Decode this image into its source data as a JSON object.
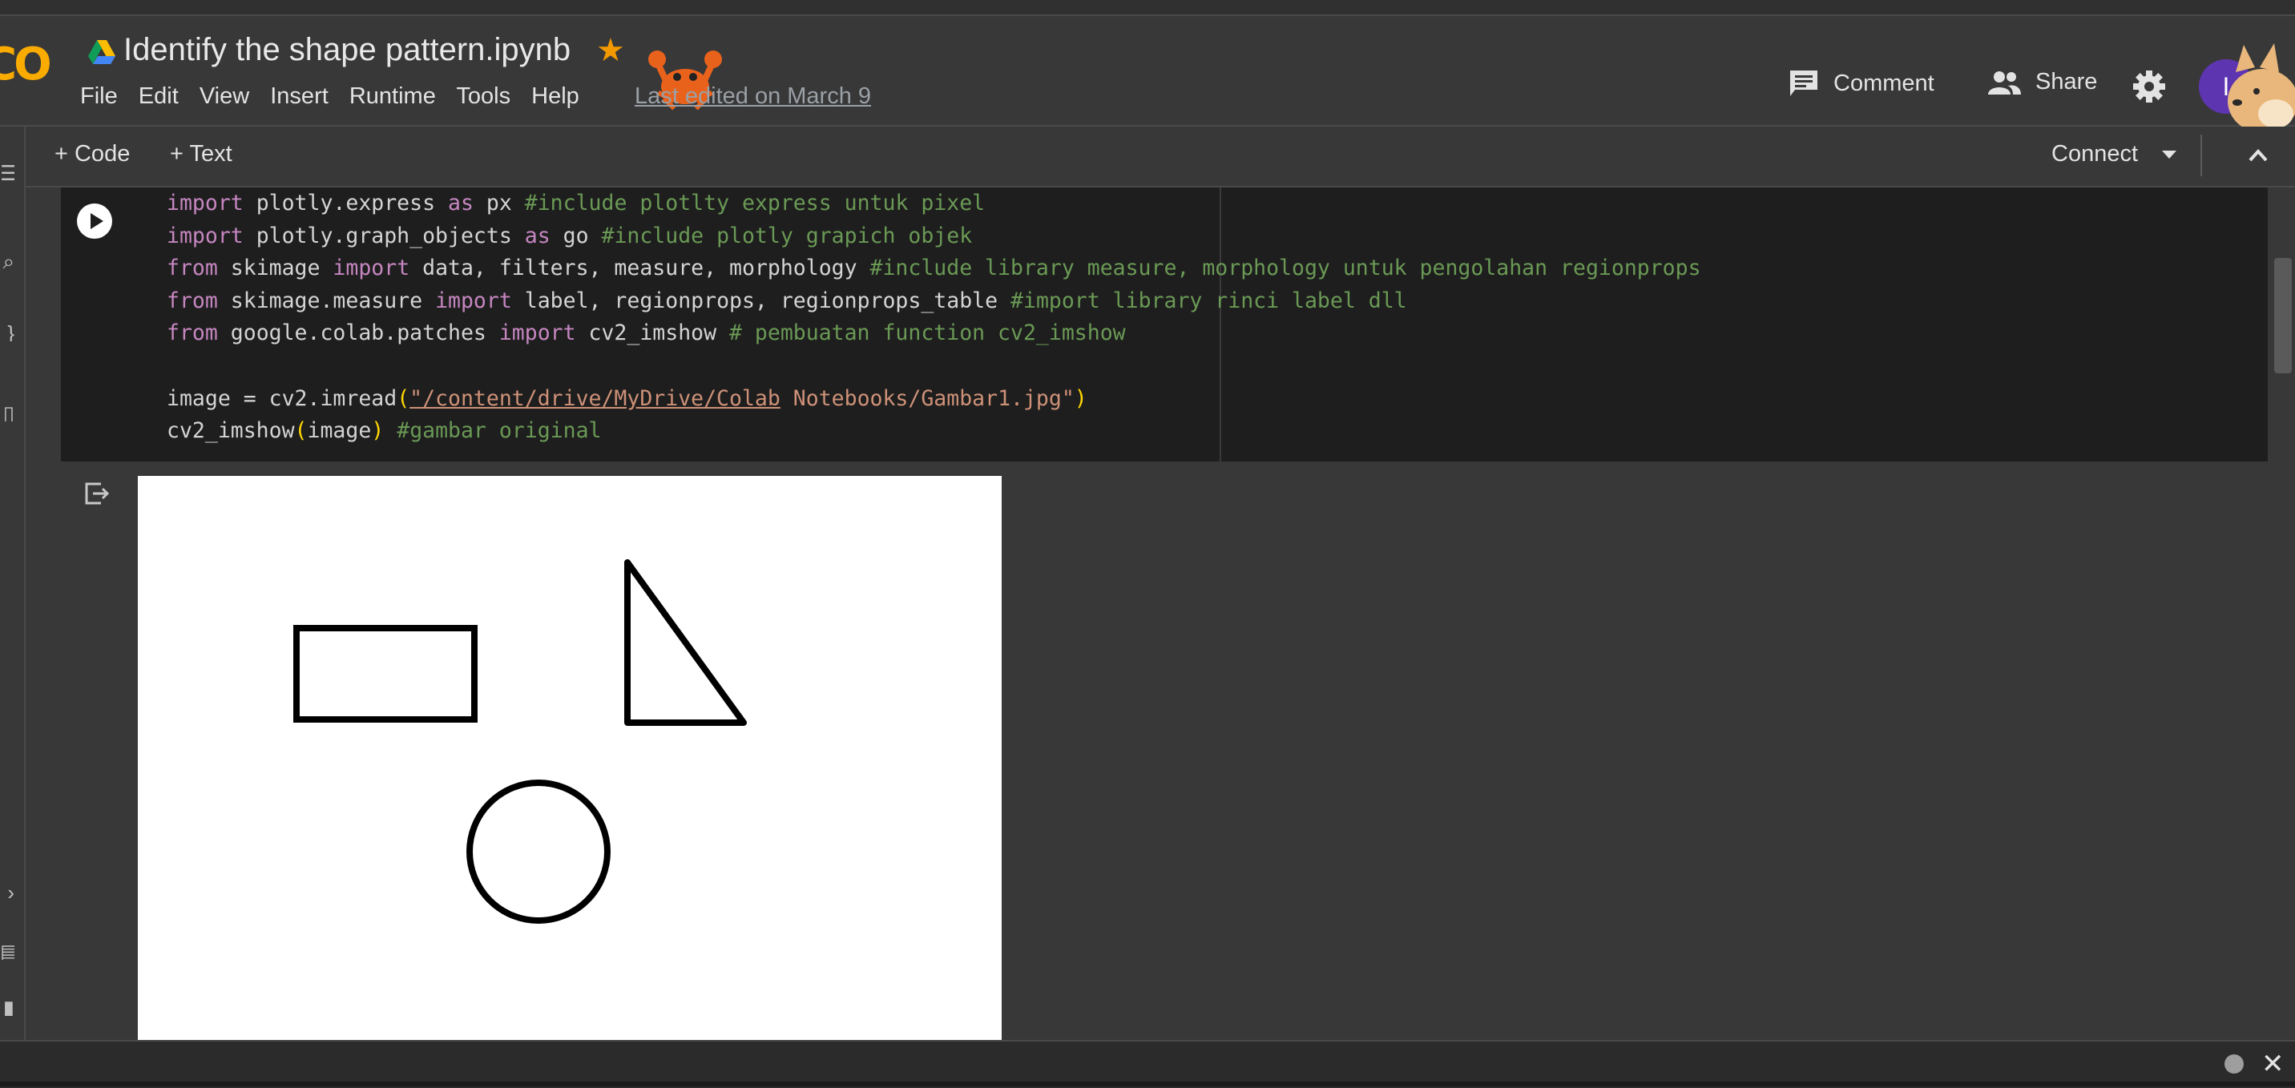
{
  "header": {
    "logo_text": "CO",
    "title": "Identify the shape pattern.ipynb",
    "last_edited": "Last edited on March 9",
    "comment_label": "Comment",
    "share_label": "Share",
    "avatar_initial": "I",
    "star_icon": "star-icon",
    "colors": {
      "logo": "#f9ab00",
      "star": "#f29900",
      "avatar": "#5e35b1"
    }
  },
  "menu": [
    "File",
    "Edit",
    "View",
    "Insert",
    "Runtime",
    "Tools",
    "Help"
  ],
  "toolbar": {
    "add_code_label": "+ Code",
    "add_text_label": "+ Text",
    "connect_label": "Connect"
  },
  "code_cell": {
    "lines": [
      [
        {
          "t": "import",
          "c": "kw"
        },
        {
          "t": " plotly.express ",
          "c": ""
        },
        {
          "t": "as",
          "c": "kw"
        },
        {
          "t": " px ",
          "c": ""
        },
        {
          "t": "#include plotlty express untuk pixel",
          "c": "cm"
        }
      ],
      [
        {
          "t": "import",
          "c": "kw"
        },
        {
          "t": " plotly.graph_objects ",
          "c": ""
        },
        {
          "t": "as",
          "c": "kw"
        },
        {
          "t": " go ",
          "c": ""
        },
        {
          "t": "#include plotly grapich objek",
          "c": "cm"
        }
      ],
      [
        {
          "t": "from",
          "c": "kw"
        },
        {
          "t": " skimage ",
          "c": ""
        },
        {
          "t": "import",
          "c": "kw"
        },
        {
          "t": " data, filters, measure, morphology ",
          "c": ""
        },
        {
          "t": "#include library measure, morphology untuk pengolahan regionprops",
          "c": "cm"
        }
      ],
      [
        {
          "t": "from",
          "c": "kw"
        },
        {
          "t": " skimage.measure ",
          "c": ""
        },
        {
          "t": "import",
          "c": "kw"
        },
        {
          "t": " label, regionprops, regionprops_table ",
          "c": ""
        },
        {
          "t": "#import library rinci label dll",
          "c": "cm"
        }
      ],
      [
        {
          "t": "from",
          "c": "kw"
        },
        {
          "t": " google.colab.patches ",
          "c": ""
        },
        {
          "t": "import",
          "c": "kw"
        },
        {
          "t": " cv2_imshow ",
          "c": ""
        },
        {
          "t": "# pembuatan function cv2_imshow",
          "c": "cm"
        }
      ],
      [],
      [
        {
          "t": "image = cv2.imread",
          "c": ""
        },
        {
          "t": "(",
          "c": "pr"
        },
        {
          "t": "\"/content/drive/MyDrive/Colab",
          "c": "st ul"
        },
        {
          "t": " Notebooks/Gambar1.jpg\"",
          "c": "st"
        },
        {
          "t": ")",
          "c": "pr"
        }
      ],
      [
        {
          "t": "cv2_imshow",
          "c": ""
        },
        {
          "t": "(",
          "c": "pr"
        },
        {
          "t": "image",
          "c": ""
        },
        {
          "t": ")",
          "c": "pr"
        },
        {
          "t": " ",
          "c": ""
        },
        {
          "t": "#gambar original",
          "c": "cm"
        }
      ]
    ]
  },
  "output": {
    "shapes": [
      "rectangle",
      "triangle",
      "circle"
    ]
  },
  "icons": {
    "run": "play-icon",
    "output": "output-redirect-icon",
    "comment": "comment-icon",
    "share": "people-icon",
    "settings": "gear-icon",
    "close": "close-icon"
  },
  "bottom": {
    "close_glyph": "✕"
  }
}
